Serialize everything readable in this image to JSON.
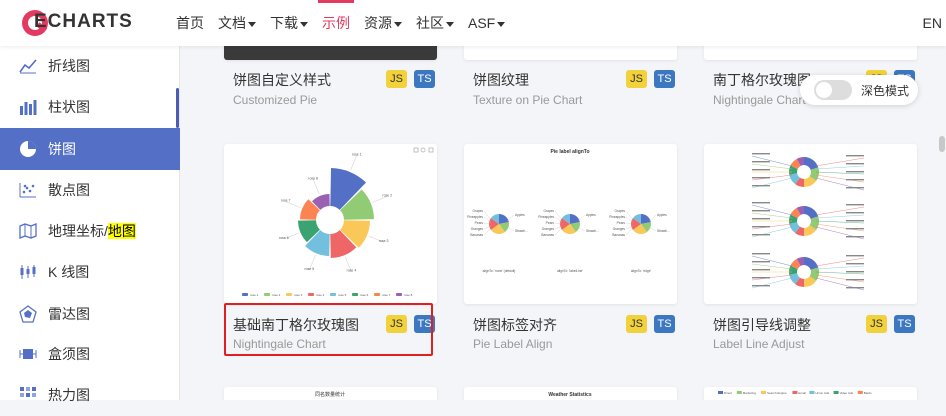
{
  "header": {
    "logo_text": "ECHARTS",
    "nav": [
      {
        "label": "首页",
        "dropdown": false,
        "active": false
      },
      {
        "label": "文档",
        "dropdown": true,
        "active": false
      },
      {
        "label": "下载",
        "dropdown": true,
        "active": false
      },
      {
        "label": "示例",
        "dropdown": false,
        "active": true
      },
      {
        "label": "资源",
        "dropdown": true,
        "active": false
      },
      {
        "label": "社区",
        "dropdown": true,
        "active": false
      },
      {
        "label": "ASF",
        "dropdown": true,
        "active": false
      }
    ],
    "lang": "EN",
    "accent": "#e43961"
  },
  "sidebar": {
    "items": [
      {
        "label": "折线图",
        "icon": "line-chart-icon"
      },
      {
        "label": "柱状图",
        "icon": "bar-chart-icon"
      },
      {
        "label": "饼图",
        "icon": "pie-chart-icon",
        "active": true
      },
      {
        "label": "散点图",
        "icon": "scatter-chart-icon"
      },
      {
        "label_prefix": "地理坐标/",
        "label_highlight": "地图",
        "icon": "map-icon"
      },
      {
        "label": "K 线图",
        "icon": "candlestick-icon"
      },
      {
        "label": "雷达图",
        "icon": "radar-chart-icon"
      },
      {
        "label": "盒须图",
        "icon": "boxplot-icon"
      },
      {
        "label": "热力图",
        "icon": "heatmap-icon"
      }
    ],
    "active_color": "#5470c6"
  },
  "cards": [
    {
      "title": "饼图自定义样式",
      "subtitle": "Customized Pie",
      "js": "JS",
      "ts": "TS"
    },
    {
      "title": "饼图纹理",
      "subtitle": "Texture on Pie Chart",
      "js": "JS",
      "ts": "TS"
    },
    {
      "title": "南丁格尔玫瑰图",
      "subtitle": "Nightingale Chart",
      "js": "JS",
      "ts": "TS"
    },
    {
      "title": "基础南丁格尔玫瑰图",
      "subtitle": "Nightingale Chart",
      "js": "JS",
      "ts": "TS",
      "selected": true
    },
    {
      "title": "饼图标签对齐",
      "subtitle": "Pie Label Align",
      "js": "JS",
      "ts": "TS"
    },
    {
      "title": "饼图引导线调整",
      "subtitle": "Label Line Adjust",
      "js": "JS",
      "ts": "TS"
    }
  ],
  "thumbs": {
    "rose": {
      "labels": [
        "rose 1",
        "rose 2",
        "rose 3",
        "rose 4",
        "rose 5",
        "rose 6",
        "rose 7",
        "rose 8"
      ],
      "colors": [
        "#5470c6",
        "#91cc75",
        "#fac858",
        "#ee6666",
        "#73c0de",
        "#3ba272",
        "#fc8452",
        "#9a60b4"
      ]
    },
    "align": {
      "title": "Pie label alignTo",
      "captions": [
        "alignTo: 'none' (default)",
        "alignTo: 'labelLine'",
        "alignTo: 'edge'"
      ],
      "labels_left": [
        "Grapes",
        "Pineapples",
        "Pears",
        "Oranges",
        "Bananas"
      ],
      "labels_right": [
        "Apples",
        "Strawb..."
      ]
    },
    "bottom": {
      "t1": "同名数量统计",
      "t2": "Weather Statistics",
      "legend3": [
        "Direct",
        "Marketing",
        "Search Engine",
        "Email",
        "Union Ads",
        "Video Ads",
        "Baidu"
      ]
    }
  },
  "dark_mode": {
    "label": "深色模式",
    "enabled": false
  }
}
